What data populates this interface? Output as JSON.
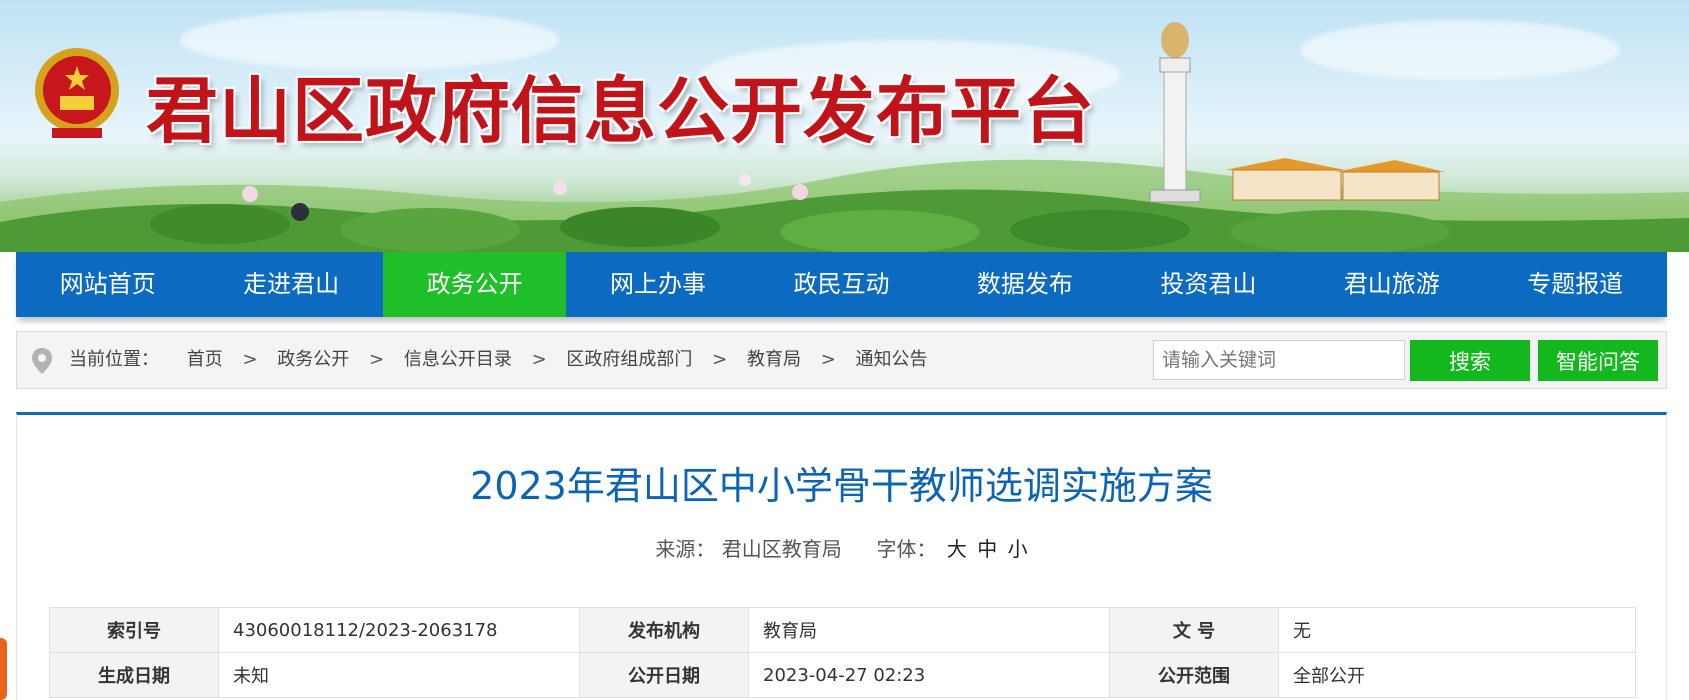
{
  "header": {
    "site_title": "君山区政府信息公开发布平台"
  },
  "nav": {
    "items": [
      {
        "label": "网站首页"
      },
      {
        "label": "走进君山"
      },
      {
        "label": "政务公开",
        "active": true
      },
      {
        "label": "网上办事"
      },
      {
        "label": "政民互动"
      },
      {
        "label": "数据发布"
      },
      {
        "label": "投资君山"
      },
      {
        "label": "君山旅游"
      },
      {
        "label": "专题报道"
      }
    ]
  },
  "breadcrumb": {
    "lead": "当前位置：",
    "items": [
      "首页",
      "政务公开",
      "信息公开目录",
      "区政府组成部门",
      "教育局",
      "通知公告"
    ],
    "separator": ">"
  },
  "search": {
    "placeholder": "请输入关键词",
    "search_button": "搜索",
    "qa_button": "智能问答"
  },
  "article": {
    "title": "2023年君山区中小学骨干教师选调实施方案",
    "source_label": "来源：",
    "source_value": "君山区教育局",
    "font_label": "字体：",
    "font_sizes": [
      "大",
      "中",
      "小"
    ]
  },
  "info_table": {
    "rows": [
      [
        {
          "key": "索引号",
          "value": "43060018112/2023-2063178"
        },
        {
          "key": "发布机构",
          "value": "教育局"
        },
        {
          "key": "文 号",
          "value": "无"
        }
      ],
      [
        {
          "key": "生成日期",
          "value": "未知"
        },
        {
          "key": "公开日期",
          "value": "2023-04-27 02:23"
        },
        {
          "key": "公开范围",
          "value": "全部公开"
        }
      ]
    ]
  },
  "colors": {
    "nav_blue": "#0c6bc0",
    "nav_active_green": "#1fbf2a",
    "button_green": "#12b81d",
    "title_red": "#c0141a",
    "article_title_blue": "#0c64b4"
  },
  "icons": [
    "national-emblem-icon",
    "location-pin-icon"
  ]
}
